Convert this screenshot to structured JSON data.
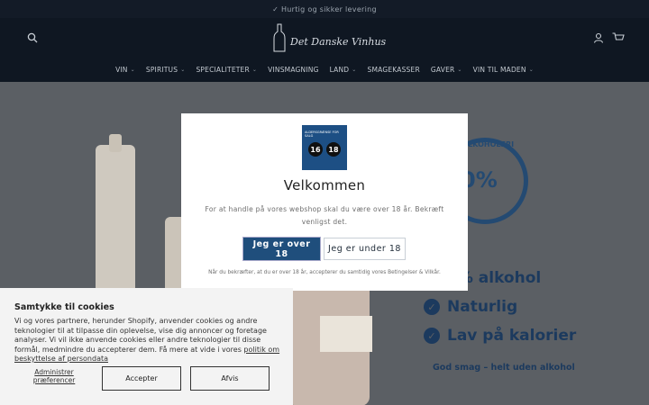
{
  "announcement": "✓ Hurtig og sikker levering",
  "brand": "Det Danske Vinhus",
  "nav": [
    {
      "label": "VIN",
      "has_menu": true
    },
    {
      "label": "SPIRITUS",
      "has_menu": true
    },
    {
      "label": "SPECIALITETER",
      "has_menu": true
    },
    {
      "label": "VINSMAGNING",
      "has_menu": false
    },
    {
      "label": "LAND",
      "has_menu": true
    },
    {
      "label": "SMAGEKASSER",
      "has_menu": false
    },
    {
      "label": "GAVER",
      "has_menu": true
    },
    {
      "label": "VIN TIL MADEN",
      "has_menu": true
    }
  ],
  "icons": {
    "search": "search-icon",
    "account": "user-icon",
    "cart": "cart-icon"
  },
  "hero": {
    "badge": "ALKOHOLFRI",
    "badge_zero": "0%",
    "features": [
      "0% alkohol",
      "Naturlig",
      "Lav på kalorier"
    ],
    "tagline": "God smag – helt uden alkohol"
  },
  "age_modal": {
    "logo_header": "ALDERSGRÆNSE FOR SALG",
    "age_16": "16",
    "age_18": "18",
    "title": "Velkommen",
    "text": "For at handle på vores webshop skal du være over 18 år. Bekræft venligst det.",
    "btn_over": "Jeg er over 18",
    "btn_under": "Jeg er under 18",
    "footer": "Når du bekræfter, at du er over 18 år, accepterer du samtidig vores Betingelser & Vilkår."
  },
  "cookie": {
    "title": "Samtykke til cookies",
    "text": "Vi og vores partnere, herunder Shopify, anvender cookies og andre teknologier til at tilpasse din oplevelse, vise dig annoncer og foretage analyser. Vi vil ikke anvende cookies eller andre teknologier til disse formål, medmindre du accepterer dem. Få mere at vide i vores ",
    "link": "politik om beskyttelse af persondata",
    "manage": "Administrer præferencer",
    "accept": "Accepter",
    "decline": "Afvis"
  },
  "colors": {
    "header_bg": "#0f1722",
    "accent": "#1f4e7c",
    "hero_bg": "#5b5f64"
  }
}
